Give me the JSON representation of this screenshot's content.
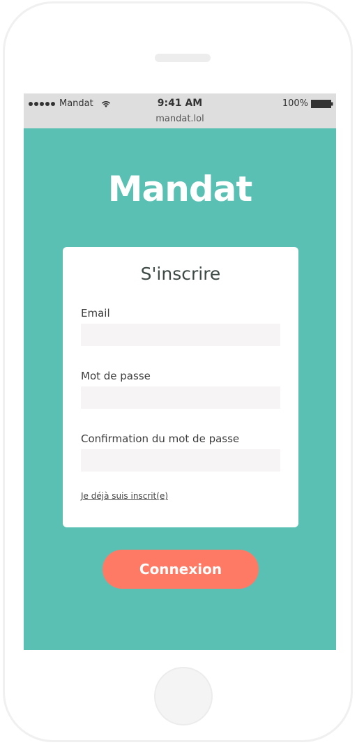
{
  "status_bar": {
    "carrier": "Mandat",
    "time": "9:41 AM",
    "battery": "100%",
    "url": "mandat.lol"
  },
  "app": {
    "logo": "Mandat"
  },
  "form": {
    "title": "S'inscrire",
    "email_label": "Email",
    "email_value": "",
    "password_label": "Mot de passe",
    "password_value": "",
    "confirm_label": "Confirmation du mot de passe",
    "confirm_value": "",
    "already_registered_link": "Je déjà suis inscrit(e)"
  },
  "actions": {
    "connect_label": "Connexion"
  },
  "colors": {
    "background": "#5bc0b4",
    "button": "#ff7a64",
    "card": "#ffffff",
    "input": "#f6f4f4"
  }
}
